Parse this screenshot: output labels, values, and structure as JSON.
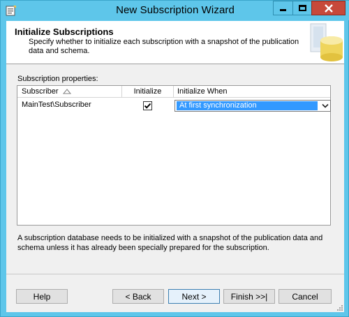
{
  "window": {
    "title": "New Subscription Wizard",
    "icons": {
      "app": "wizard-app-icon",
      "minimize": "minimize-icon",
      "maximize": "maximize-icon",
      "close": "close-icon"
    }
  },
  "header": {
    "title": "Initialize Subscriptions",
    "description": "Specify whether to initialize each subscription with a snapshot of the publication data and schema.",
    "art": "database-wizard-icon"
  },
  "properties": {
    "label": "Subscription properties:",
    "columns": {
      "subscriber": "Subscriber",
      "initialize": "Initialize",
      "initialize_when": "Initialize When"
    },
    "sort_icon": "sort-ascending-icon",
    "rows": [
      {
        "subscriber": "MainTest\\Subscriber",
        "initialize": true,
        "initialize_when": "At first synchronization"
      }
    ]
  },
  "note": "A subscription database needs to be initialized with a snapshot of the publication data and schema unless it has already been specially prepared for the subscription.",
  "buttons": {
    "help": "Help",
    "back": "< Back",
    "next": "Next >",
    "finish": "Finish >>|",
    "cancel": "Cancel"
  },
  "colors": {
    "frame": "#5ec6ea",
    "close_button": "#c7493a",
    "selection": "#3399ff",
    "dialog_background": "#f0f0f0"
  }
}
